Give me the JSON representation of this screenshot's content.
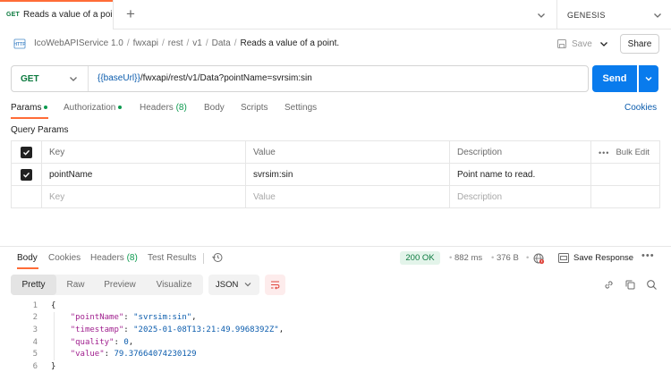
{
  "tab": {
    "method_badge": "GET",
    "title": "Reads a value of a point."
  },
  "environment": {
    "name": "GENESIS"
  },
  "breadcrumb": {
    "items": [
      "IcoWebAPIService 1.0",
      "fwxapi",
      "rest",
      "v1",
      "Data"
    ],
    "current": "Reads a value of a point.",
    "separator": "/"
  },
  "header_actions": {
    "save_label": "Save",
    "share_label": "Share"
  },
  "request": {
    "method": "GET",
    "url_variable": "{{baseUrl}}",
    "url_path": "/fwxapi/rest/v1/Data?pointName=svrsim:sin",
    "send_label": "Send"
  },
  "request_tabs": [
    {
      "label": "Params",
      "active": true,
      "dot": true
    },
    {
      "label": "Authorization",
      "active": false,
      "dot": true
    },
    {
      "label": "Headers",
      "count": "(8)",
      "active": false
    },
    {
      "label": "Body",
      "active": false
    },
    {
      "label": "Scripts",
      "active": false
    },
    {
      "label": "Settings",
      "active": false
    }
  ],
  "cookies_label": "Cookies",
  "query_params": {
    "section_label": "Query Params",
    "headers": {
      "key": "Key",
      "value": "Value",
      "description": "Description",
      "bulk_edit": "Bulk Edit"
    },
    "rows": [
      {
        "key": "pointName",
        "value": "svrsim:sin",
        "description": "Point name to read.",
        "checked": true
      }
    ],
    "placeholder": {
      "key": "Key",
      "value": "Value",
      "description": "Description"
    }
  },
  "response_tabs": [
    {
      "label": "Body",
      "active": true
    },
    {
      "label": "Cookies",
      "active": false
    },
    {
      "label": "Headers",
      "count": "(8)",
      "active": false
    },
    {
      "label": "Test Results",
      "active": false
    }
  ],
  "response_meta": {
    "status": "200 OK",
    "time": "882 ms",
    "size": "376 B",
    "save_label": "Save Response",
    "status_color": "#0c7a3f"
  },
  "view_modes": [
    "Pretty",
    "Raw",
    "Preview",
    "Visualize"
  ],
  "active_view": "Pretty",
  "format": "JSON",
  "response_body": {
    "line_numbers": [
      "1",
      "2",
      "3",
      "4",
      "5",
      "6"
    ],
    "open_brace": "{",
    "close_brace": "}",
    "fields": [
      {
        "key": "\"pointName\"",
        "value": "\"svrsim:sin\"",
        "type": "string",
        "comma": ","
      },
      {
        "key": "\"timestamp\"",
        "value": "\"2025-01-08T13:21:49.9968392Z\"",
        "type": "string",
        "comma": ","
      },
      {
        "key": "\"quality\"",
        "value": "0",
        "type": "number",
        "comma": ","
      },
      {
        "key": "\"value\"",
        "value": "79.37664074230129",
        "type": "number",
        "comma": ""
      }
    ]
  },
  "colors": {
    "accent": "#ff6c37",
    "primary": "#097bed",
    "method_get": "#0c7a3f",
    "json_key": "#a01f8e",
    "json_value": "#0b5cad"
  }
}
